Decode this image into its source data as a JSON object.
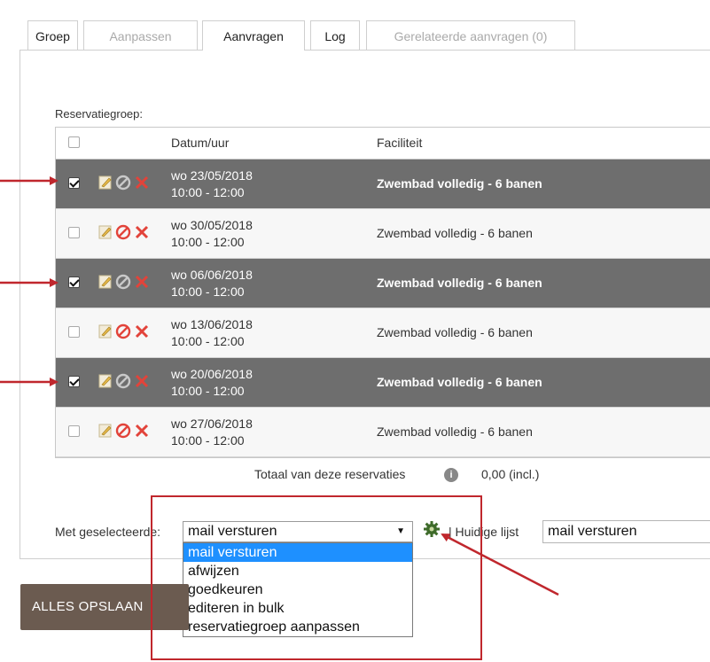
{
  "tabs": [
    {
      "label": "Groep",
      "state": "normal"
    },
    {
      "label": "Aanpassen",
      "state": "disabled"
    },
    {
      "label": "Aanvragen",
      "state": "active"
    },
    {
      "label": "Log",
      "state": "normal"
    },
    {
      "label": "Gerelateerde aanvragen (0)",
      "state": "disabled"
    }
  ],
  "group_label": "Reservatiegroep:",
  "table": {
    "columns": [
      "Datum/uur",
      "Faciliteit"
    ],
    "rows": [
      {
        "date": "wo 23/05/2018",
        "time": "10:00 - 12:00",
        "facility": "Zwembad volledig - 6 banen",
        "selected": true
      },
      {
        "date": "wo 30/05/2018",
        "time": "10:00 - 12:00",
        "facility": "Zwembad volledig - 6 banen",
        "selected": false
      },
      {
        "date": "wo 06/06/2018",
        "time": "10:00 - 12:00",
        "facility": "Zwembad volledig - 6 banen",
        "selected": true
      },
      {
        "date": "wo 13/06/2018",
        "time": "10:00 - 12:00",
        "facility": "Zwembad volledig - 6 banen",
        "selected": false
      },
      {
        "date": "wo 20/06/2018",
        "time": "10:00 - 12:00",
        "facility": "Zwembad volledig - 6 banen",
        "selected": true
      },
      {
        "date": "wo 27/06/2018",
        "time": "10:00 - 12:00",
        "facility": "Zwembad volledig - 6 banen",
        "selected": false
      }
    ],
    "row_icons": [
      "edit-icon",
      "cancel-circle-icon",
      "delete-x-icon"
    ]
  },
  "totals": {
    "label": "Totaal van deze reservaties",
    "info_icon": "i",
    "amount": "0,00 (incl.)"
  },
  "bulk": {
    "label": "Met geselecteerde:",
    "selected": "mail versturen",
    "options": [
      "mail versturen",
      "afwijzen",
      "goedkeuren",
      "editeren in bulk",
      "reservatiegroep aanpassen"
    ],
    "current_list_label": "| Huidige lijst",
    "current_list_value": "mail versturen"
  },
  "save_button": "ALLES OPSLAAN",
  "colors": {
    "selected_row": "#6e6e6e",
    "annotation_red": "#c0272d",
    "highlight_option": "#1e90ff",
    "save_button": "#6b5b50"
  }
}
